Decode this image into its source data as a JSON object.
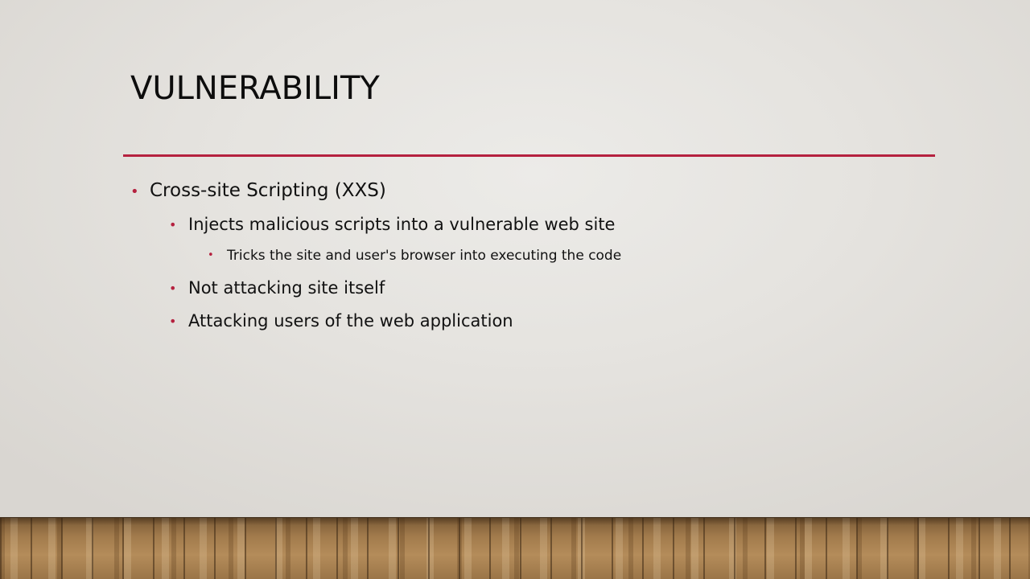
{
  "slide": {
    "title": "Vulnerability",
    "accent_color": "#b5213f",
    "bullets": [
      {
        "level": 1,
        "text": "Cross-site Scripting (XXS)"
      },
      {
        "level": 2,
        "text": "Injects malicious scripts into a vulnerable web site"
      },
      {
        "level": 3,
        "text": "Tricks the site and user's browser into executing the code"
      },
      {
        "level": 2,
        "text": "Not attacking site itself"
      },
      {
        "level": 2,
        "text": "Attacking users of the web application"
      }
    ],
    "bullet_glyph": "•"
  }
}
